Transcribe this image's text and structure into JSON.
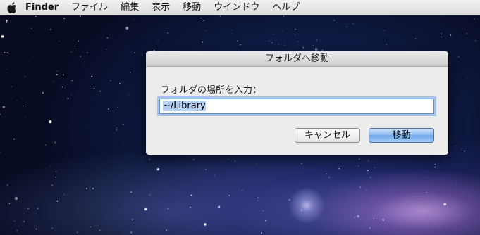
{
  "menubar": {
    "app_name": "Finder",
    "items": [
      "ファイル",
      "編集",
      "表示",
      "移動",
      "ウインドウ",
      "ヘルプ"
    ]
  },
  "dialog": {
    "title": "フォルダへ移動",
    "prompt": "フォルダの場所を入力：",
    "path_value": "~/Library",
    "cancel_label": "キャンセル",
    "go_label": "移動"
  },
  "colors": {
    "menubar_bg": "#e6e6e6",
    "dialog_bg": "#ececec",
    "focus_ring": "#5b8fd4",
    "default_button": "#86b6ee"
  }
}
